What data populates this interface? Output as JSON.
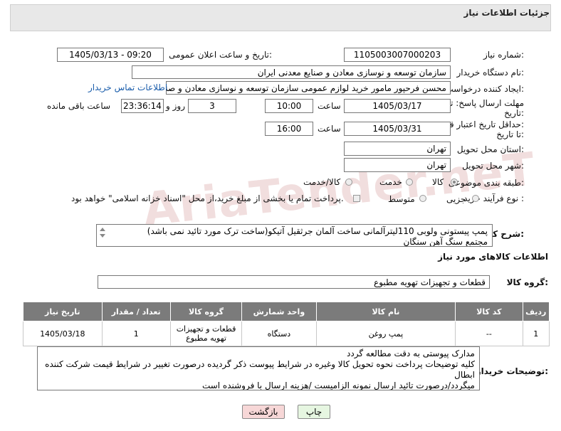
{
  "header": {
    "title": "جزئیات اطلاعات نیاز"
  },
  "fields": {
    "need_number_label": "شماره نیاز:",
    "need_number": "1105003007000203",
    "announce_label": "تاریخ و ساعت اعلان عمومی:",
    "announce_value": "1405/03/13 - 09:20",
    "buyer_org_label": "نام دستگاه خریدار:",
    "buyer_org": "سازمان توسعه و نوسازی معادن و صنایع معدنی ایران",
    "requester_label": "ایجاد کننده درخواست:",
    "requester": "محسن فرحپور مامور خرید لوازم عمومی سازمان توسعه و نوسازی معادن و صنایع",
    "contact_link": "اطلاعات تماس خریدار",
    "deadline_label_1": "مهلت ارسال پاسخ: تا",
    "deadline_label_2": "تاریخ:",
    "deadline_date": "1405/03/17",
    "time_label": "ساعت",
    "deadline_time": "10:00",
    "days_value": "3",
    "days_label": "روز و",
    "remaining_time": "23:36:14",
    "remaining_label": "ساعت باقی مانده",
    "validity_label_1": "حداقل تاریخ اعتبار قیمت:",
    "validity_label_2": "تا تاریخ:",
    "validity_date": "1405/03/31",
    "validity_time": "16:00",
    "province_label": "استان محل تحویل:",
    "province": "تهران",
    "city_label": "شهر محل تحویل:",
    "city": "تهران",
    "category_label": "طبقه بندی موضوعی:",
    "category_options": [
      "کالا",
      "خدمت",
      "کالا/خدمت"
    ],
    "category_selected": "کالا",
    "process_label": "نوع فرآیند خرید :",
    "process_options": [
      "جزیی",
      "متوسط"
    ],
    "process_selected": "",
    "payment_note": "پرداخت تمام یا بخشی از مبلغ خرید،از محل \"اسناد خزانه اسلامی\" خواهد بود."
  },
  "description": {
    "label": "شرح کلی نیاز:",
    "line1": "پمپ پیستونی ولوبی 110لیترآلمانی ساخت آلمان  جرثقیل آتیکو(ساخت ترک مورد تائید نمی باشد)",
    "line2": "مجتمع سنگ آهن سنگان"
  },
  "goods_info_title": "اطلاعات کالاهای مورد نیاز",
  "goods_group": {
    "label": "گروه کالا:",
    "value": "قطعات و تجهیزات تهویه مطبوع"
  },
  "table": {
    "headers": [
      "ردیف",
      "کد کالا",
      "نام کالا",
      "واحد شمارش",
      "گروه کالا",
      "تعداد / مقدار",
      "تاریخ نیاز"
    ],
    "rows": [
      [
        "1",
        "--",
        "پمپ روغن",
        "دستگاه",
        "قطعات و تجهیزات تهویه مطبوع",
        "1",
        "1405/03/18"
      ]
    ]
  },
  "buyer_notes": {
    "label": "توضیحات خریدار:",
    "line1": "مدارک پیوستی به دقت مطالعه گردد",
    "line2": "کلیه توضیحات پرداخت نحوه تحویل کالا وغیره در شرایط پیوست ذکر گردیده درصورت تغییر در شرایط  قیمت شرکت کننده ابطال",
    "line3": "میگردد/درصورت تائید ارسال نمونه الزامیست /هزینه ارسال با فروشنده است"
  },
  "buttons": {
    "print": "چاپ",
    "back": "بازگشت"
  },
  "watermark": "AriaTender.neT",
  "colors": {
    "header_bg": "#e8e8e8",
    "table_header_bg": "#7b7b7b",
    "back_button_bg": "#f7d7d7",
    "print_button_bg": "#e6f6e1",
    "link": "#1a5dab"
  }
}
